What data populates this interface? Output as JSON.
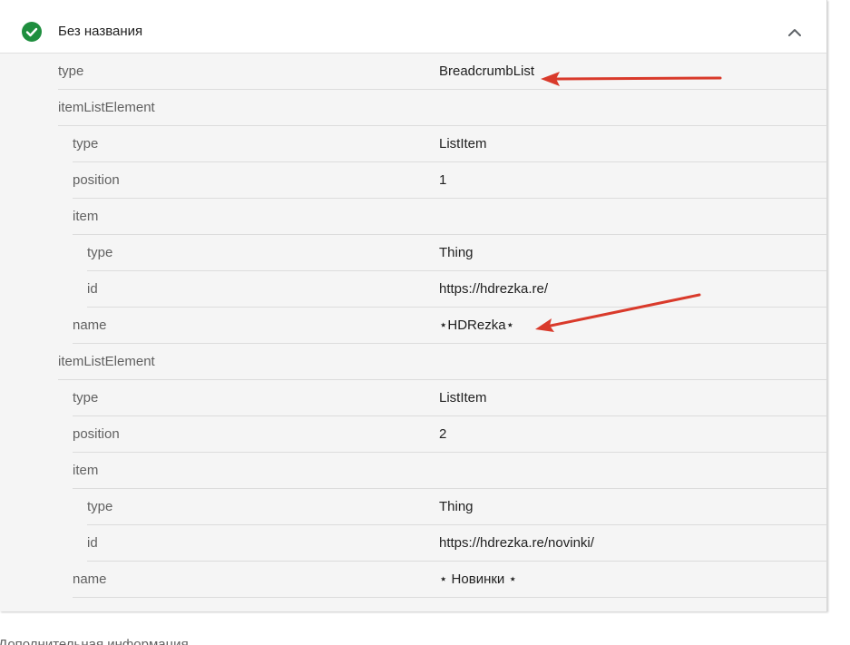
{
  "header": {
    "title": "Без названия",
    "status_icon": "check-circle-icon",
    "collapse_icon": "chevron-up-icon",
    "status_color": "#1e8e3e"
  },
  "rows": [
    {
      "key": "type",
      "value": "BreadcrumbList",
      "level": 0
    },
    {
      "key": "itemListElement",
      "value": "",
      "level": 0
    },
    {
      "key": "type",
      "value": "ListItem",
      "level": 1
    },
    {
      "key": "position",
      "value": "1",
      "level": 1
    },
    {
      "key": "item",
      "value": "",
      "level": 1
    },
    {
      "key": "type",
      "value": "Thing",
      "level": 2
    },
    {
      "key": "id",
      "value": "https://hdrezka.re/",
      "level": 2
    },
    {
      "key": "name",
      "value": "⋆HDRezka⋆",
      "level": 1
    },
    {
      "key": "itemListElement",
      "value": "",
      "level": 0
    },
    {
      "key": "type",
      "value": "ListItem",
      "level": 1
    },
    {
      "key": "position",
      "value": "2",
      "level": 1
    },
    {
      "key": "item",
      "value": "",
      "level": 1
    },
    {
      "key": "type",
      "value": "Thing",
      "level": 2
    },
    {
      "key": "id",
      "value": "https://hdrezka.re/novinki/",
      "level": 2
    },
    {
      "key": "name",
      "value": "⋆ Новинки ⋆",
      "level": 1
    }
  ],
  "footer": {
    "text": "Дополнительная информация"
  },
  "annotation_color": "#d93a2b"
}
